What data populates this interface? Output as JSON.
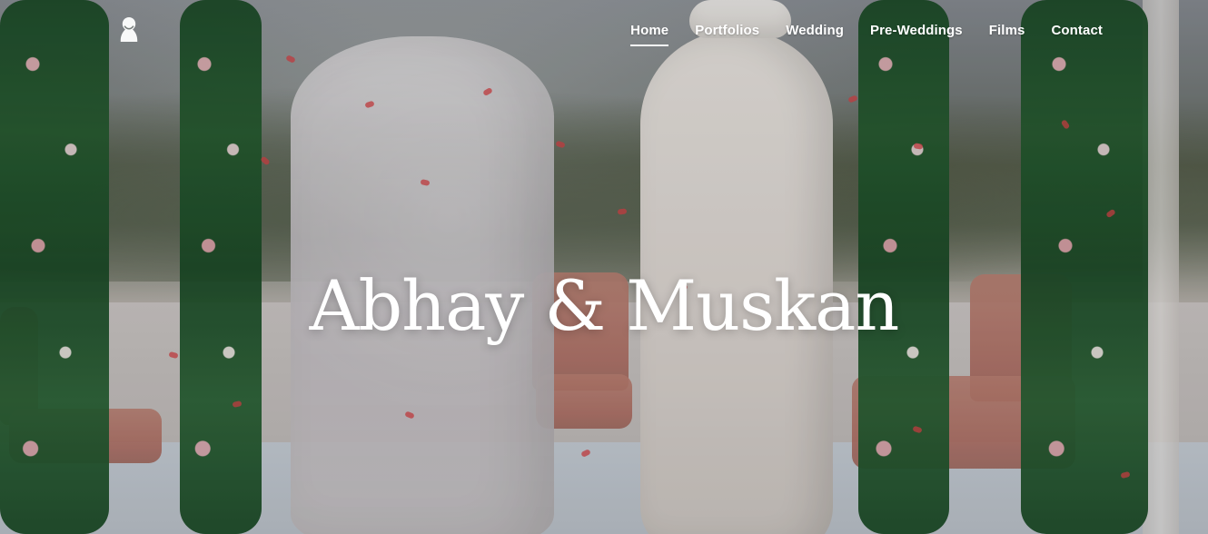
{
  "nav": {
    "links": [
      {
        "label": "Home",
        "active": true
      },
      {
        "label": "Portfolios",
        "active": false
      },
      {
        "label": "Wedding",
        "active": false
      },
      {
        "label": "Pre-Weddings",
        "active": false
      },
      {
        "label": "Films",
        "active": false
      },
      {
        "label": "Contact",
        "active": false
      }
    ]
  },
  "hero": {
    "title": "Abhay & Muskan"
  },
  "icons": {
    "logo": "bride-silhouette-icon"
  }
}
